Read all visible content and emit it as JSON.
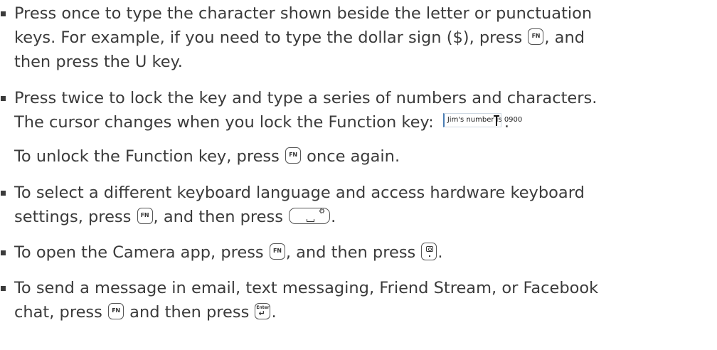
{
  "items": [
    {
      "line1": "Press once to type the character shown beside the letter or punctuation",
      "line2_a": "keys. For example, if you need to type the dollar sign ($), press ",
      "line2_b": ", and",
      "line3": "then press the U key."
    },
    {
      "line1": "Press twice to lock the key and type a series of numbers and characters.",
      "line2": "The cursor changes when you lock the Function key: ",
      "line2_end": ".",
      "cursor_sample": "Jim's number is 0900",
      "line3_a": "To unlock the Function key, press ",
      "line3_b": " once again."
    },
    {
      "line1": "To select a different keyboard language and access hardware keyboard",
      "line2_a": "settings, press ",
      "line2_b": ", and then press ",
      "line2_c": "."
    },
    {
      "line1_a": "To open the Camera app, press ",
      "line1_b": ", and then press ",
      "line1_c": "."
    },
    {
      "line1": "To send a message in email, text messaging, Friend Stream, or Facebook",
      "line2_a": "chat, press ",
      "line2_b": " and then press ",
      "line2_c": "."
    }
  ],
  "keys": {
    "fn_label": "FN",
    "enter_label": "Enter",
    "enter_arrow": "↵",
    "gear_glyph": "⚙"
  }
}
